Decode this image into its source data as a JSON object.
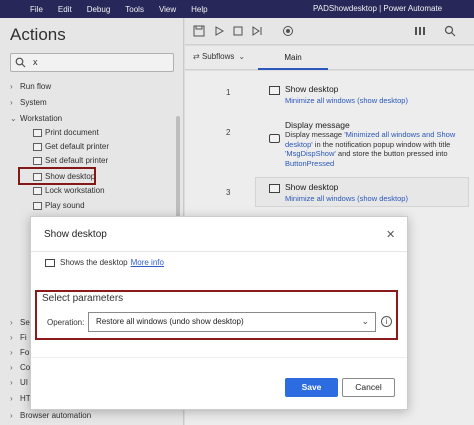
{
  "menu": [
    "File",
    "Edit",
    "Debug",
    "Tools",
    "View",
    "Help"
  ],
  "app_title": "PADShowdesktop | Power Automate",
  "actions_panel": {
    "title": "Actions",
    "search_value": "x",
    "groups_top": [
      {
        "label": "Run flow",
        "expanded": false
      },
      {
        "label": "System",
        "expanded": false
      },
      {
        "label": "Workstation",
        "expanded": true
      }
    ],
    "workstation_items": [
      "Print document",
      "Get default printer",
      "Set default printer",
      "Show desktop",
      "Lock workstation",
      "Play sound"
    ],
    "groups_bottom": [
      "Se",
      "Fi",
      "Fo",
      "Co",
      "UI",
      "HT"
    ],
    "browser_automation": "Browser automation"
  },
  "tabs": {
    "subflows": "Subflows",
    "main": "Main"
  },
  "steps": [
    {
      "num": "1",
      "title": "Show desktop",
      "desc": "Minimize all windows (show desktop)"
    },
    {
      "num": "2",
      "title": "Display message",
      "desc_parts": [
        "Display message ",
        "'Minimized all windows and Show desktop'",
        " in the notification popup window with title ",
        "'MsgDispShow'",
        " and store the button pressed into ",
        "ButtonPressed"
      ]
    },
    {
      "num": "3",
      "title": "Show desktop",
      "desc": "Minimize all windows (show desktop)"
    }
  ],
  "dialog": {
    "title": "Show desktop",
    "description": "Shows the desktop",
    "more_info": "More info",
    "params_title": "Select parameters",
    "operation_label": "Operation:",
    "operation_value": "Restore all windows (undo show desktop)",
    "save": "Save",
    "cancel": "Cancel"
  },
  "colors": {
    "titlebar": "#2a2a5e",
    "accent": "#2c6be0",
    "highlight": "#8b1a1a"
  }
}
